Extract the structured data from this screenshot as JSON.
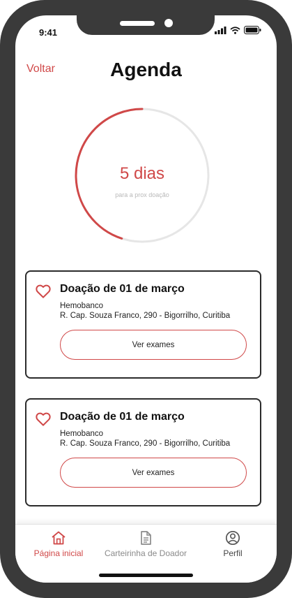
{
  "status_bar": {
    "time": "9:41"
  },
  "header": {
    "back_label": "Voltar",
    "title": "Agenda"
  },
  "countdown": {
    "value": "5 dias",
    "caption": "para a prox doação",
    "progress": 0.45
  },
  "donations": [
    {
      "title": "Doação de 01 de março",
      "place": "Hemobanco",
      "address": "R. Cap. Souza Franco, 290 - Bigorrilho, Curitiba",
      "button_label": "Ver exames"
    },
    {
      "title": "Doação de 01 de março",
      "place": "Hemobanco",
      "address": "R. Cap. Souza Franco, 290 - Bigorrilho, Curitiba",
      "button_label": "Ver exames"
    }
  ],
  "nav": {
    "items": [
      {
        "label": "Página inicial",
        "icon": "home-icon",
        "active": true
      },
      {
        "label": "Carteirinha de Doador",
        "icon": "document-icon",
        "active": false
      },
      {
        "label": "Perfil",
        "icon": "user-icon",
        "active": false
      }
    ]
  },
  "colors": {
    "accent": "#d04848",
    "ring_track": "#e6e6e6",
    "muted_text": "#8a8a8a"
  }
}
